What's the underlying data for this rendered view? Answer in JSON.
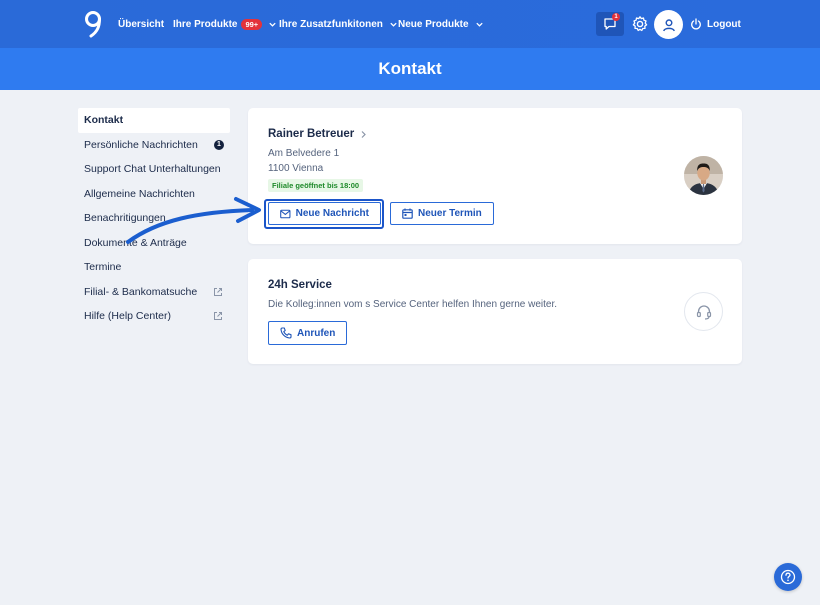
{
  "nav": {
    "items": [
      {
        "label": "Übersicht"
      },
      {
        "label": "Ihre Produkte",
        "badge": "99+"
      },
      {
        "label": "Ihre Zusatzfunkitonen"
      },
      {
        "label": "Neue Produkte"
      }
    ],
    "chat_badge": "1",
    "logout_label": "Logout"
  },
  "page": {
    "title": "Kontakt"
  },
  "sidebar": {
    "items": [
      {
        "label": "Kontakt"
      },
      {
        "label": "Persönliche Nachrichten",
        "count": "1"
      },
      {
        "label": "Support Chat Unterhaltungen"
      },
      {
        "label": "Allgemeine Nachrichten"
      },
      {
        "label": "Benachritigungen"
      },
      {
        "label": "Dokumente & Anträge"
      },
      {
        "label": "Termine"
      },
      {
        "label": "Filial- & Bankomatsuche"
      },
      {
        "label": "Hilfe (Help Center)"
      }
    ]
  },
  "advisor_card": {
    "name": "Rainer Betreuer",
    "street": "Am Belvedere 1",
    "city": "1100 Vienna",
    "status": "Filiale geöffnet bis 18:00",
    "message_button": "Neue Nachricht",
    "appointment_button": "Neuer Termin"
  },
  "service_card": {
    "title": "24h Service",
    "description": "Die Kolleg:innen vom s Service Center helfen Ihnen gerne weiter.",
    "call_button": "Anrufen"
  },
  "colors": {
    "nav_bg": "#2a6ad8",
    "header_bg": "#2f7bf0",
    "accent": "#1f55b8",
    "badge_red": "#e3323b",
    "open_green": "#1f8a2b"
  }
}
